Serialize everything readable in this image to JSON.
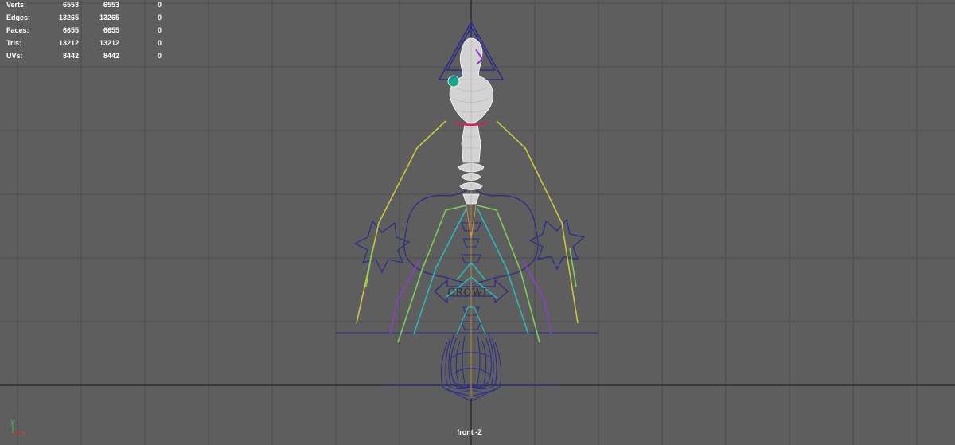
{
  "hud": {
    "rows": [
      {
        "label": "Verts:",
        "v1": "6553",
        "v2": "6553",
        "v3": "0"
      },
      {
        "label": "Edges:",
        "v1": "13265",
        "v2": "13265",
        "v3": "0"
      },
      {
        "label": "Faces:",
        "v1": "6655",
        "v2": "6655",
        "v3": "0"
      },
      {
        "label": "Tris:",
        "v1": "13212",
        "v2": "13212",
        "v3": "0"
      },
      {
        "label": "UVs:",
        "v1": "8442",
        "v2": "8442",
        "v3": "0"
      }
    ]
  },
  "viewport": {
    "camera_label": "front -Z",
    "control_text": "CROWL",
    "axis_y": "y",
    "axis_x": "x",
    "colors": {
      "background": "#5e5e5e",
      "grid": "#4a4a4a",
      "grid_axis": "#2e2e2e",
      "wireframe": "#ffffff",
      "control_curve": "#2a2a8c",
      "joint_green": "#7cd05a",
      "joint_yellow": "#c8d040",
      "joint_teal": "#2ab8b8",
      "joint_purple": "#8a40c8",
      "joint_orange": "#d09040",
      "accent_red": "#d02060"
    }
  }
}
